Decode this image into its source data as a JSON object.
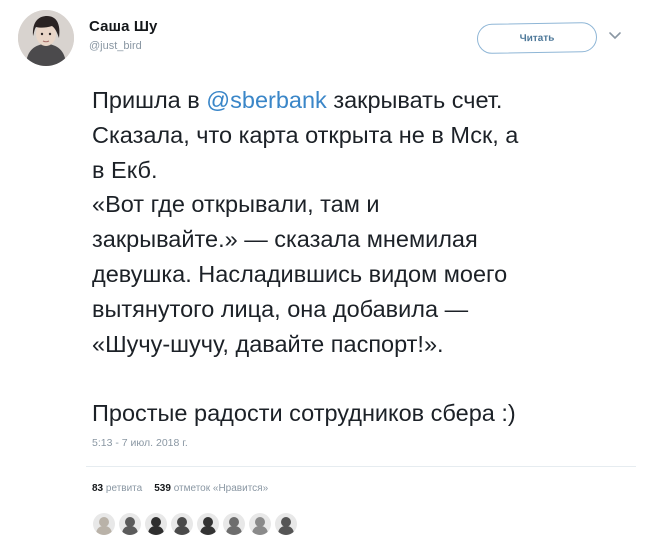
{
  "author": {
    "name": "Саша Шу",
    "handle": "@just_bird"
  },
  "follow_button_label": "Читать",
  "tweet": {
    "text_before_mention": "Пришла в ",
    "mention": "@sberbank",
    "text_after_mention": " закрывать счет.\nСказала, что карта открыта не в Мск, а\nв Екб.\n«Вот где открывали, там и\nзакрывайте.» — сказала мнемилая\nдевушка. Насладившись видом моего\nвытянутого лица, она добавила —\n«Шучу-шучу, давайте паспорт!».\n\nПростые радости сотрудников сбера :)",
    "timestamp": "5:13 - 7 июл. 2018 г."
  },
  "stats": {
    "retweets_count": "83",
    "retweets_label": "ретвита",
    "likes_count": "539",
    "likes_label": "отметок «Нравится»"
  },
  "likers": [
    {
      "icon": "liker-avatar-1",
      "color": "#b9b2a8"
    },
    {
      "icon": "liker-avatar-2",
      "color": "#5b5b5b"
    },
    {
      "icon": "liker-avatar-3",
      "color": "#2f2f2f"
    },
    {
      "icon": "liker-avatar-4",
      "color": "#4a4a4a"
    },
    {
      "icon": "liker-avatar-5",
      "color": "#333333"
    },
    {
      "icon": "liker-avatar-6",
      "color": "#6d6d6d"
    },
    {
      "icon": "liker-avatar-7",
      "color": "#8a8a8a"
    },
    {
      "icon": "liker-avatar-8",
      "color": "#555555"
    }
  ],
  "colors": {
    "mention": "#3a86c8",
    "follow_border": "#8fb6d6",
    "muted": "#8a97a3"
  }
}
